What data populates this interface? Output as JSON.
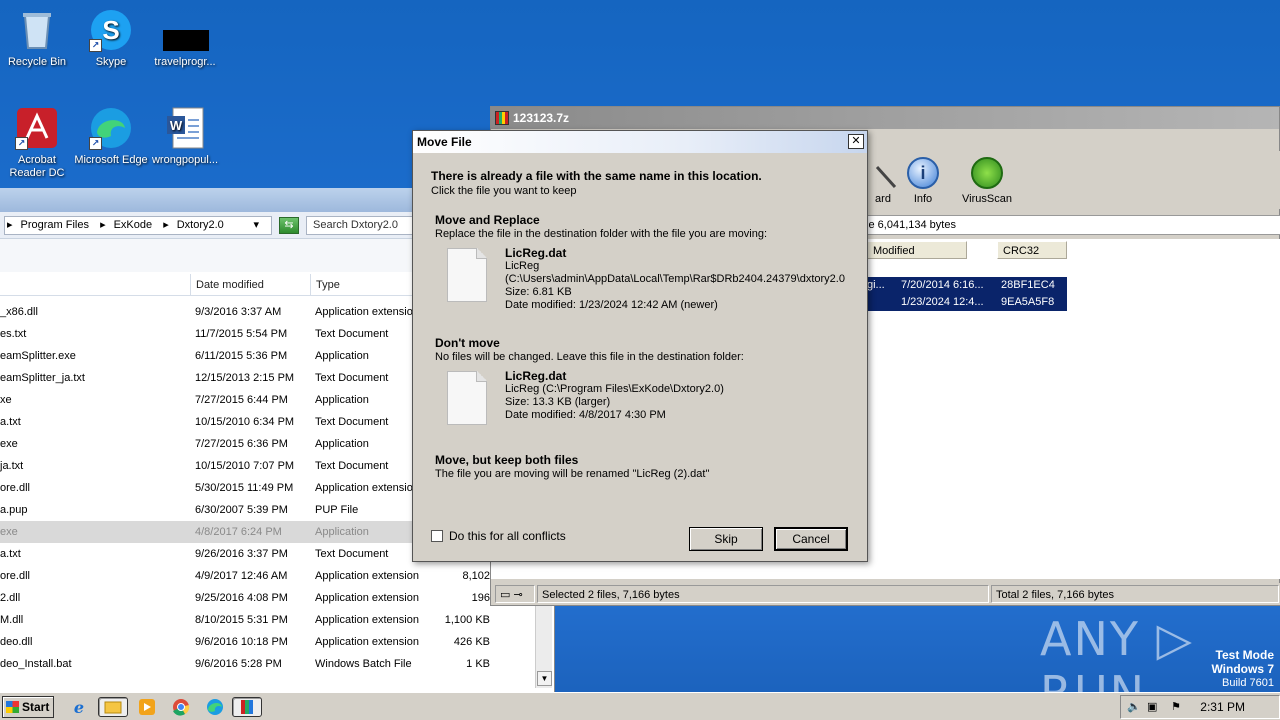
{
  "desktop": {
    "icons": [
      {
        "label": "Recycle Bin",
        "icon": "recycle-bin-icon"
      },
      {
        "label": "Skype",
        "icon": "skype-icon"
      },
      {
        "label": "travelprogr...",
        "icon": "blacked-out-icon"
      },
      {
        "label": "Acrobat Reader DC",
        "icon": "acrobat-icon"
      },
      {
        "label": "Microsoft Edge",
        "icon": "edge-icon"
      },
      {
        "label": "wrongpopul...",
        "icon": "word-doc-icon"
      }
    ]
  },
  "explorer": {
    "breadcrumbs": [
      "Program Files",
      "ExKode",
      "Dxtory2.0"
    ],
    "search_placeholder": "Search Dxtory2.0",
    "columns": {
      "date": "Date modified",
      "type": "Type"
    },
    "rows": [
      {
        "name": "_x86.dll",
        "date": "9/3/2016 3:37 AM",
        "type": "Application extensio",
        "size": ""
      },
      {
        "name": "es.txt",
        "date": "11/7/2015 5:54 PM",
        "type": "Text Document",
        "size": ""
      },
      {
        "name": "eamSplitter.exe",
        "date": "6/11/2015 5:36 PM",
        "type": "Application",
        "size": ""
      },
      {
        "name": "eamSplitter_ja.txt",
        "date": "12/15/2013 2:15 PM",
        "type": "Text Document",
        "size": ""
      },
      {
        "name": "xe",
        "date": "7/27/2015 6:44 PM",
        "type": "Application",
        "size": ""
      },
      {
        "name": "a.txt",
        "date": "10/15/2010 6:34 PM",
        "type": "Text Document",
        "size": ""
      },
      {
        "name": "exe",
        "date": "7/27/2015 6:36 PM",
        "type": "Application",
        "size": ""
      },
      {
        "name": "ja.txt",
        "date": "10/15/2010 7:07 PM",
        "type": "Text Document",
        "size": ""
      },
      {
        "name": "ore.dll",
        "date": "5/30/2015 11:49 PM",
        "type": "Application extensio",
        "size": ""
      },
      {
        "name": "a.pup",
        "date": "6/30/2007 5:39 PM",
        "type": "PUP File",
        "size": ""
      },
      {
        "name": "exe",
        "date": "4/8/2017 6:24 PM",
        "type": "Application",
        "size": ""
      },
      {
        "name": "a.txt",
        "date": "9/26/2016 3:37 PM",
        "type": "Text Document",
        "size": ""
      },
      {
        "name": "ore.dll",
        "date": "4/9/2017 12:46 AM",
        "type": "Application extension",
        "size": "8,102"
      },
      {
        "name": "2.dll",
        "date": "9/25/2016 4:08 PM",
        "type": "Application extension",
        "size": "196"
      },
      {
        "name": "M.dll",
        "date": "8/10/2015 5:31 PM",
        "type": "Application extension",
        "size": "1,100 KB"
      },
      {
        "name": "deo.dll",
        "date": "9/6/2016 10:18 PM",
        "type": "Application extension",
        "size": "426 KB"
      },
      {
        "name": "deo_Install.bat",
        "date": "9/6/2016 5:28 PM",
        "type": "Windows Batch File",
        "size": "1 KB"
      }
    ]
  },
  "zip": {
    "title": "123123.7z",
    "tools": [
      "ard",
      "Info",
      "VirusScan"
    ],
    "address_tail": "ze 6,041,134 bytes",
    "columns": {
      "modified": "Modified",
      "crc": "CRC32"
    },
    "rows": [
      {
        "name": "gi...",
        "modified": "7/20/2014 6:16...",
        "crc": "28BF1EC4"
      },
      {
        "name": "",
        "modified": "1/23/2024 12:4...",
        "crc": "9EA5A5F8"
      }
    ],
    "status_selected": "Selected 2 files, 7,166 bytes",
    "status_total": "Total 2 files, 7,166 bytes"
  },
  "dialog": {
    "title": "Move File",
    "heading": "There is already a file with the same name in this location.",
    "subheading": "Click the file you want to keep",
    "replace": {
      "title": "Move and Replace",
      "desc": "Replace the file in the destination folder with the file you are moving:",
      "file_name": "LicReg.dat",
      "file_line1": "LicReg",
      "file_line2": "(C:\\Users\\admin\\AppData\\Local\\Temp\\Rar$DRb2404.24379\\dxtory2.0",
      "file_size": "Size: 6.81 KB",
      "file_date": "Date modified: 1/23/2024 12:42 AM (newer)"
    },
    "dont_move": {
      "title": "Don't move",
      "desc": "No files will be changed. Leave this file in the destination folder:",
      "file_name": "LicReg.dat",
      "file_line1": "LicReg (C:\\Program Files\\ExKode\\Dxtory2.0)",
      "file_size": "Size: 13.3 KB (larger)",
      "file_date": "Date modified: 4/8/2017 4:30 PM"
    },
    "keep_both": {
      "title": "Move, but keep both files",
      "desc": "The file you are moving will be renamed \"LicReg (2).dat\""
    },
    "checkbox_label": "Do this for all conflicts",
    "skip_label": "Skip",
    "cancel_label": "Cancel"
  },
  "watermark": {
    "logo": "ANY ▷ RUN",
    "test_mode": "Test Mode",
    "os": "Windows 7",
    "build": "Build 7601"
  },
  "taskbar": {
    "start_label": "Start",
    "clock": "2:31 PM"
  }
}
